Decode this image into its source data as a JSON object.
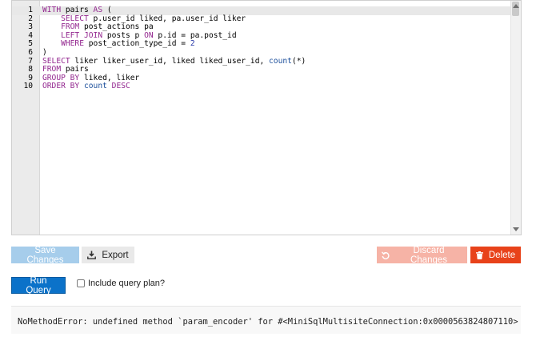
{
  "editor": {
    "lines": [
      {
        "number": "1",
        "tokens": [
          {
            "t": "WITH",
            "c": "kw"
          },
          {
            "t": " pairs "
          },
          {
            "t": "AS",
            "c": "kw"
          },
          {
            "t": " ("
          }
        ]
      },
      {
        "number": "2",
        "tokens": [
          {
            "t": "    "
          },
          {
            "t": "SELECT",
            "c": "kw"
          },
          {
            "t": " p.user_id liked, pa.user_id liker"
          }
        ]
      },
      {
        "number": "3",
        "tokens": [
          {
            "t": "    "
          },
          {
            "t": "FROM",
            "c": "kw"
          },
          {
            "t": " post_actions pa"
          }
        ]
      },
      {
        "number": "4",
        "tokens": [
          {
            "t": "    "
          },
          {
            "t": "LEFT JOIN",
            "c": "kw"
          },
          {
            "t": " posts p "
          },
          {
            "t": "ON",
            "c": "kw"
          },
          {
            "t": " p.id = pa.post_id"
          }
        ]
      },
      {
        "number": "5",
        "tokens": [
          {
            "t": "    "
          },
          {
            "t": "WHERE",
            "c": "kw"
          },
          {
            "t": " post_action_type_id = "
          },
          {
            "t": "2",
            "c": "num"
          }
        ]
      },
      {
        "number": "6",
        "tokens": [
          {
            "t": ")"
          }
        ]
      },
      {
        "number": "7",
        "tokens": [
          {
            "t": "SELECT",
            "c": "kw"
          },
          {
            "t": " liker liker_user_id, liked liked_user_id, "
          },
          {
            "t": "count",
            "c": "fn"
          },
          {
            "t": "(*)"
          }
        ]
      },
      {
        "number": "8",
        "tokens": [
          {
            "t": "FROM",
            "c": "kw"
          },
          {
            "t": " pairs"
          }
        ]
      },
      {
        "number": "9",
        "tokens": [
          {
            "t": "GROUP BY",
            "c": "kw"
          },
          {
            "t": " liked, liker"
          }
        ]
      },
      {
        "number": "10",
        "tokens": [
          {
            "t": "ORDER BY",
            "c": "kw"
          },
          {
            "t": " "
          },
          {
            "t": "count",
            "c": "fn"
          },
          {
            "t": " "
          },
          {
            "t": "DESC",
            "c": "kw"
          }
        ]
      }
    ]
  },
  "toolbar": {
    "save_label": "Save Changes",
    "export_label": "Export",
    "discard_label": "Discard Changes",
    "delete_label": "Delete"
  },
  "run": {
    "run_label": "Run Query",
    "include_plan_label": "Include query plan?"
  },
  "error": {
    "message": "NoMethodError: undefined method `param_encoder' for #<MiniSqlMultisiteConnection:0x0000563824807110>"
  },
  "colors": {
    "keyword": "#93278f",
    "function": "#1c4f9b",
    "primary": "#0b72c9",
    "danger": "#e8421a"
  }
}
